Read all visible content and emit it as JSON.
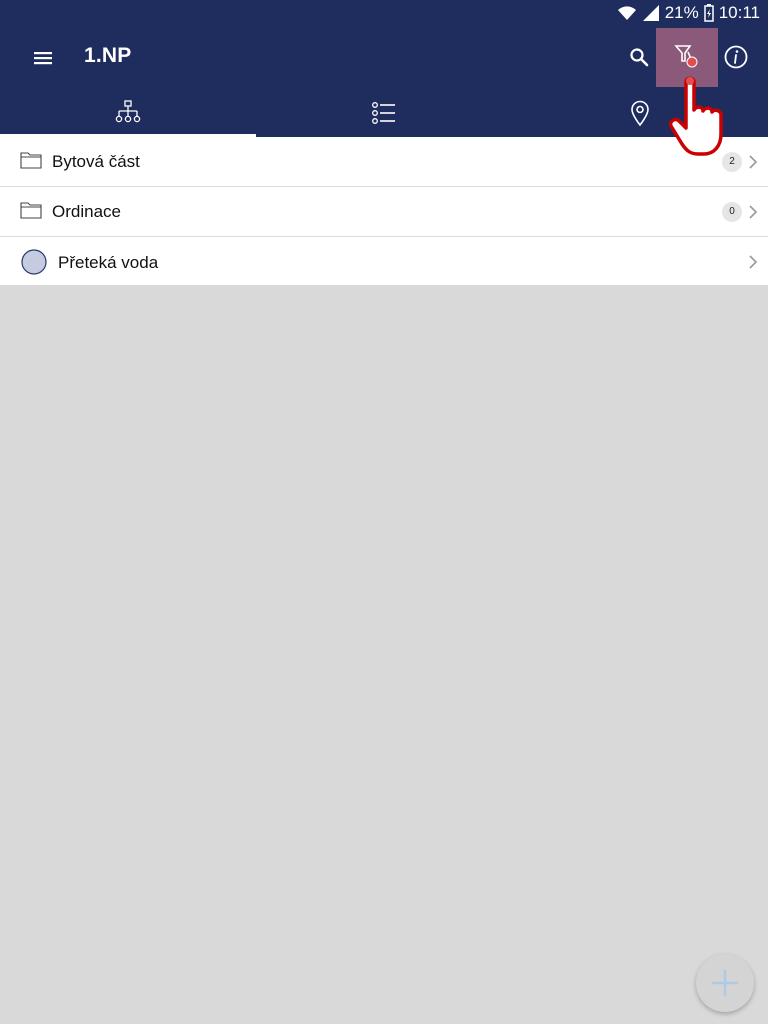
{
  "status_bar": {
    "battery": "21%",
    "time": "10:11"
  },
  "toolbar": {
    "title": "1.NP",
    "icons": {
      "menu": "menu-icon",
      "search": "search-icon",
      "filter": "filter-icon",
      "info": "info-icon"
    },
    "filter_highlight_color": "#8b5a7a"
  },
  "tabs": [
    {
      "icon": "hierarchy-icon",
      "active": true
    },
    {
      "icon": "list-icon",
      "active": false
    },
    {
      "icon": "location-pin-icon",
      "active": false
    }
  ],
  "list": [
    {
      "type": "folder",
      "label": "Bytová část",
      "count": "2"
    },
    {
      "type": "folder",
      "label": "Ordinace",
      "count": "0"
    },
    {
      "type": "item",
      "label": "Přeteká voda"
    }
  ],
  "colors": {
    "app_bar": "#1e2d5e",
    "background": "#d9d9d9",
    "item_circle": "#c5cbe0"
  },
  "fab": {
    "icon": "plus-icon"
  }
}
